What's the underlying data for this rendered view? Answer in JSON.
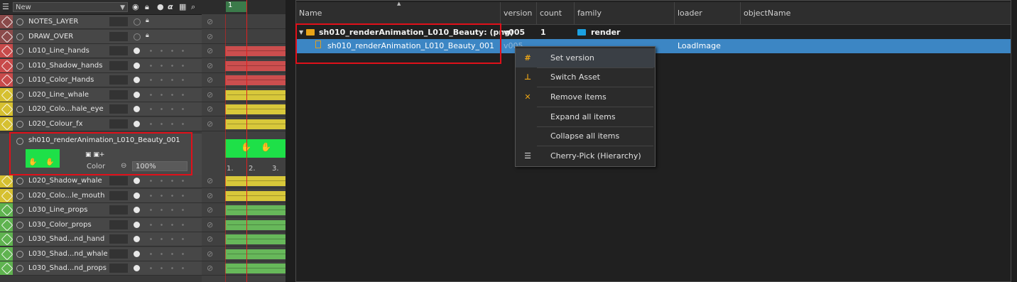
{
  "layers_panel": {
    "new_label": "New",
    "header_icons": [
      "layers-icon",
      "eye-icon",
      "lock-icon",
      "bulb-icon",
      "alpha-icon",
      "grid-icon",
      "search-icon"
    ],
    "alpha_glyph": "α",
    "layers": [
      {
        "name": "NOTES_LAYER",
        "color": "#8b4a4a"
      },
      {
        "name": "DRAW_OVER",
        "color": "#8b4a4a"
      },
      {
        "name": "L010_Line_hands",
        "color": "#c84a4a"
      },
      {
        "name": "L010_Shadow_hands",
        "color": "#c84a4a"
      },
      {
        "name": "L010_Color_Hands",
        "color": "#c84a4a"
      },
      {
        "name": "L020_Line_whale",
        "color": "#d6c030"
      },
      {
        "name": "L020_Colo...hale_eye",
        "color": "#d6c030"
      },
      {
        "name": "L020_Colour_fx",
        "color": "#d6c030"
      },
      {
        "name": "L020_Shadow_whale",
        "color": "#d6c030"
      },
      {
        "name": "L020_Colo...le_mouth",
        "color": "#d6c030"
      },
      {
        "name": "L030_Line_props",
        "color": "#5fb34f"
      },
      {
        "name": "L030_Color_props",
        "color": "#5fb34f"
      },
      {
        "name": "L030_Shad...nd_hand",
        "color": "#5fb34f"
      },
      {
        "name": "L030_Shad...nd_whale",
        "color": "#5fb34f"
      },
      {
        "name": "L030_Shad...nd_props",
        "color": "#5fb34f"
      }
    ],
    "selected_layer": {
      "name": "sh010_renderAnimation_L010_Beauty_001",
      "color_label": "Color",
      "opacity": "100%"
    }
  },
  "timeline": {
    "current_frame": "1",
    "frame_numbers": [
      "1.",
      "2.",
      "3."
    ]
  },
  "inventory": {
    "columns": [
      "Name",
      "version",
      "count",
      "family",
      "loader",
      "objectName"
    ],
    "rows": [
      {
        "name": "sh010_renderAnimation_L010_Beauty: (png)",
        "version": "v005",
        "count": "1",
        "family": "render",
        "loader": "",
        "objectName": ""
      },
      {
        "name": "sh010_renderAnimation_L010_Beauty_001",
        "version": "v005",
        "count": "",
        "family": "",
        "loader": "LoadImage",
        "objectName": ""
      }
    ],
    "colors": {
      "folder": "#e8a317",
      "render_folder": "#1ba1e2",
      "selected_row": "#3c86c4",
      "highlight_box": "#e0101a"
    }
  },
  "context_menu": {
    "items": [
      {
        "label": "Set version",
        "icon": "hash-icon",
        "glyph": "#",
        "icon_color": "#e8a317"
      },
      {
        "label": "Switch Asset",
        "icon": "hierarchy-icon",
        "glyph": "⊥",
        "icon_color": "#e8a317"
      },
      {
        "label": "Remove items",
        "icon": "close-icon",
        "glyph": "✕",
        "icon_color": "#e8a317"
      },
      {
        "label": "Expand all items",
        "icon": "",
        "glyph": "",
        "icon_color": ""
      },
      {
        "label": "Collapse all items",
        "icon": "",
        "glyph": "",
        "icon_color": ""
      },
      {
        "label": "Cherry-Pick (Hierarchy)",
        "icon": "list-indent-icon",
        "glyph": "☰",
        "icon_color": "#e0e0e0"
      }
    ]
  }
}
